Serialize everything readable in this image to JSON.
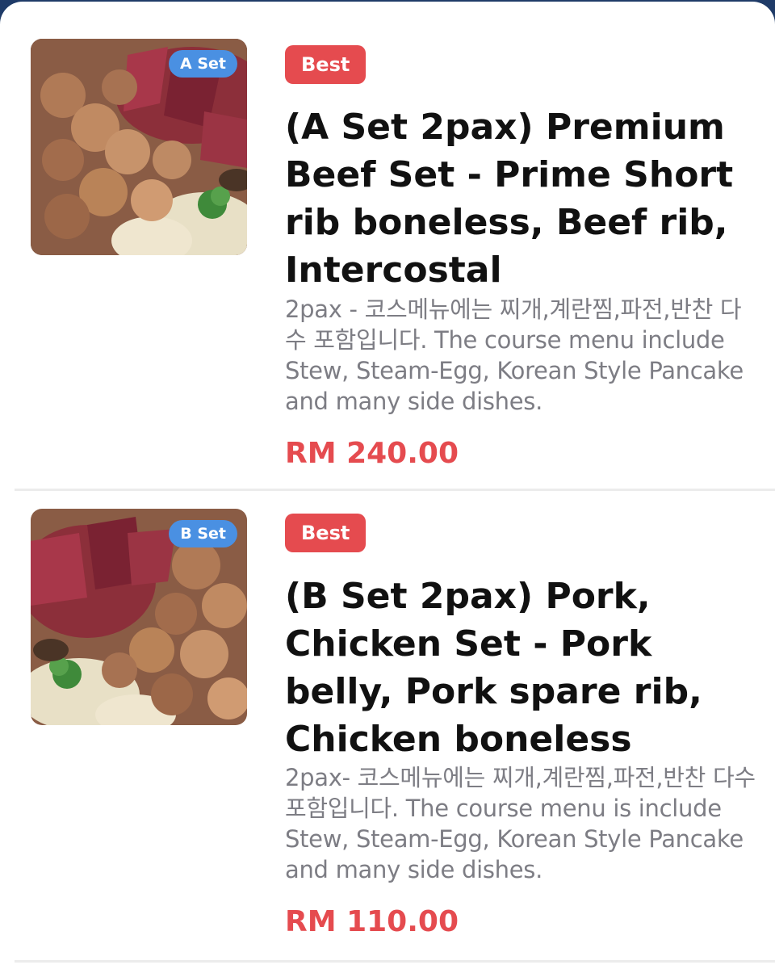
{
  "colors": {
    "accent_red": "#e54b4f",
    "badge_blue": "#4a90e2",
    "title_text": "#111111",
    "desc_text": "#7d7d84",
    "background": "#ffffff"
  },
  "menu": {
    "items": [
      {
        "image_icon": "food-photo-icon",
        "set_badge": "A Set",
        "tag": "Best",
        "title": "(A Set 2pax) Premium Beef Set - Prime Short rib boneless, Beef rib, Intercostal",
        "description": "2pax - 코스메뉴에는 찌개,계란찜,파전,반찬 다수 포함입니다. The course menu include Stew, Steam-Egg, Korean Style Pancake and many side dishes.",
        "price": "RM 240.00"
      },
      {
        "image_icon": "food-photo-icon",
        "set_badge": "B Set",
        "tag": "Best",
        "title": "(B Set 2pax) Pork, Chicken Set - Pork belly, Pork spare rib, Chicken boneless",
        "description": "2pax- 코스메뉴에는 찌개,계란찜,파전,반찬 다수 포함입니다. The course menu is include Stew, Steam-Egg, Korean Style Pancake and many side dishes.",
        "price": "RM 110.00"
      }
    ]
  }
}
